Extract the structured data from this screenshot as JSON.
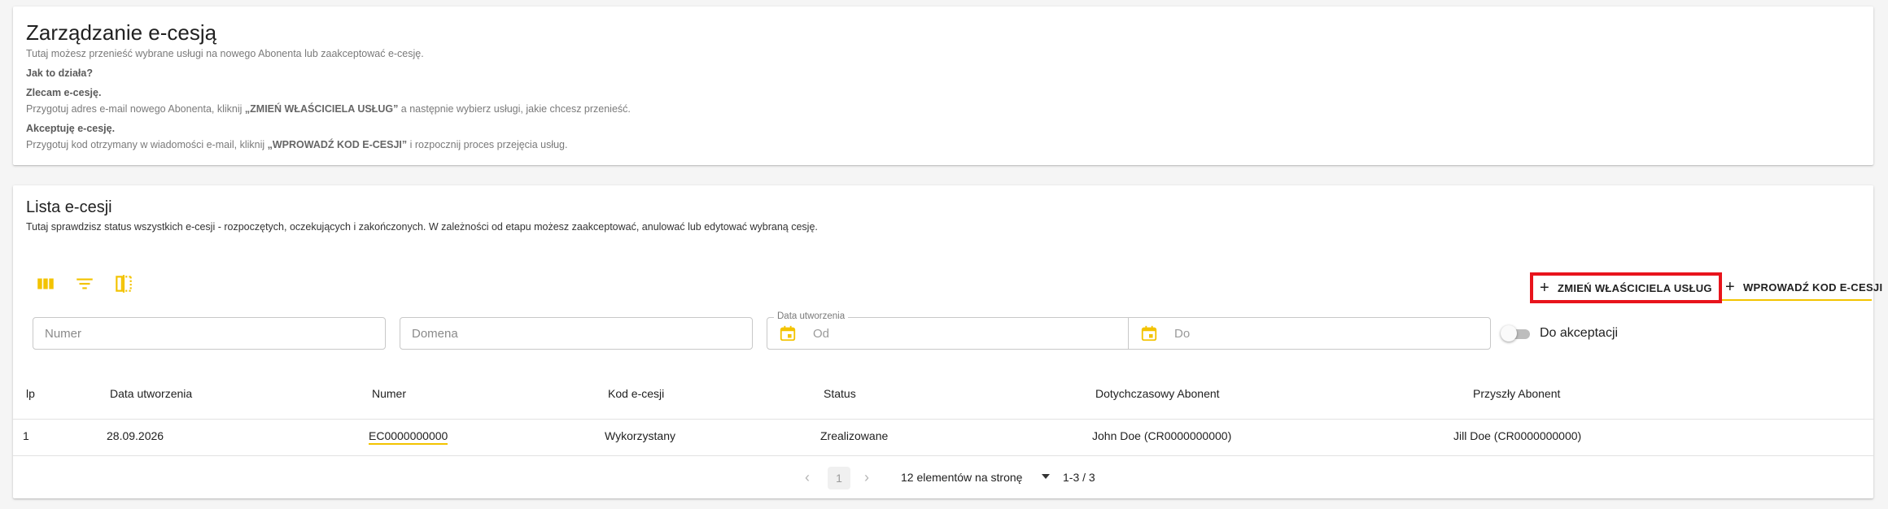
{
  "info": {
    "title": "Zarządzanie e-cesją",
    "intro": "Tutaj możesz przenieść wybrane usługi na nowego Abonenta lub zaakceptować e-cesję.",
    "how_heading": "Jak to działa?",
    "order_heading": "Zlecam e-cesję.",
    "order_pre": "Przygotuj adres e-mail nowego Abonenta, kliknij ",
    "order_bold": "„ZMIEŃ WŁAŚCICIELA USŁUG”",
    "order_post": " a następnie wybierz usługi, jakie chcesz przenieść.",
    "accept_heading": "Akceptuję e-cesję.",
    "accept_pre": "Przygotuj kod otrzymany w wiadomości e-mail, kliknij ",
    "accept_bold": "„WPROWADŹ KOD E-CESJI”",
    "accept_post": " i rozpocznij proces przejęcia usług."
  },
  "list": {
    "title": "Lista e-cesji",
    "description": "Tutaj sprawdzisz status wszystkich e-cesji - rozpoczętych, oczekujących i zakończonych. W zależności od etapu możesz zaakceptować, anulować lub edytować wybraną cesję.",
    "actions": {
      "change_owner": "ZMIEŃ WŁAŚCICIELA USŁUG",
      "enter_code": "WPROWADŹ KOD E-CESJI"
    },
    "filters": {
      "numer_placeholder": "Numer",
      "domena_placeholder": "Domena",
      "date_label": "Data utworzenia",
      "date_from_placeholder": "Od",
      "date_to_placeholder": "Do",
      "toggle_label": "Do akceptacji"
    },
    "columns": [
      "lp",
      "Data utworzenia",
      "Numer",
      "Kod e-cesji",
      "Status",
      "Dotychczasowy Abonent",
      "Przyszły Abonent"
    ],
    "rows": [
      [
        "1",
        "28.09.2026",
        "EC0000000000",
        "Wykorzystany",
        "Zrealizowane",
        "John Doe (CR0000000000)",
        "Jill Doe (CR0000000000)"
      ]
    ],
    "pagination": {
      "page": "1",
      "page_size": "12 elementów na stronę",
      "range": "1-3 / 3"
    }
  },
  "colors": {
    "accent": "#f3c300",
    "highlight": "#e8141c",
    "background": "#f5f5f5"
  },
  "icons": [
    "grid-view-icon",
    "filter-icon",
    "columns-icon",
    "plus-icon",
    "calendar-icon",
    "chevron-left-icon",
    "chevron-right-icon",
    "caret-down-icon"
  ]
}
